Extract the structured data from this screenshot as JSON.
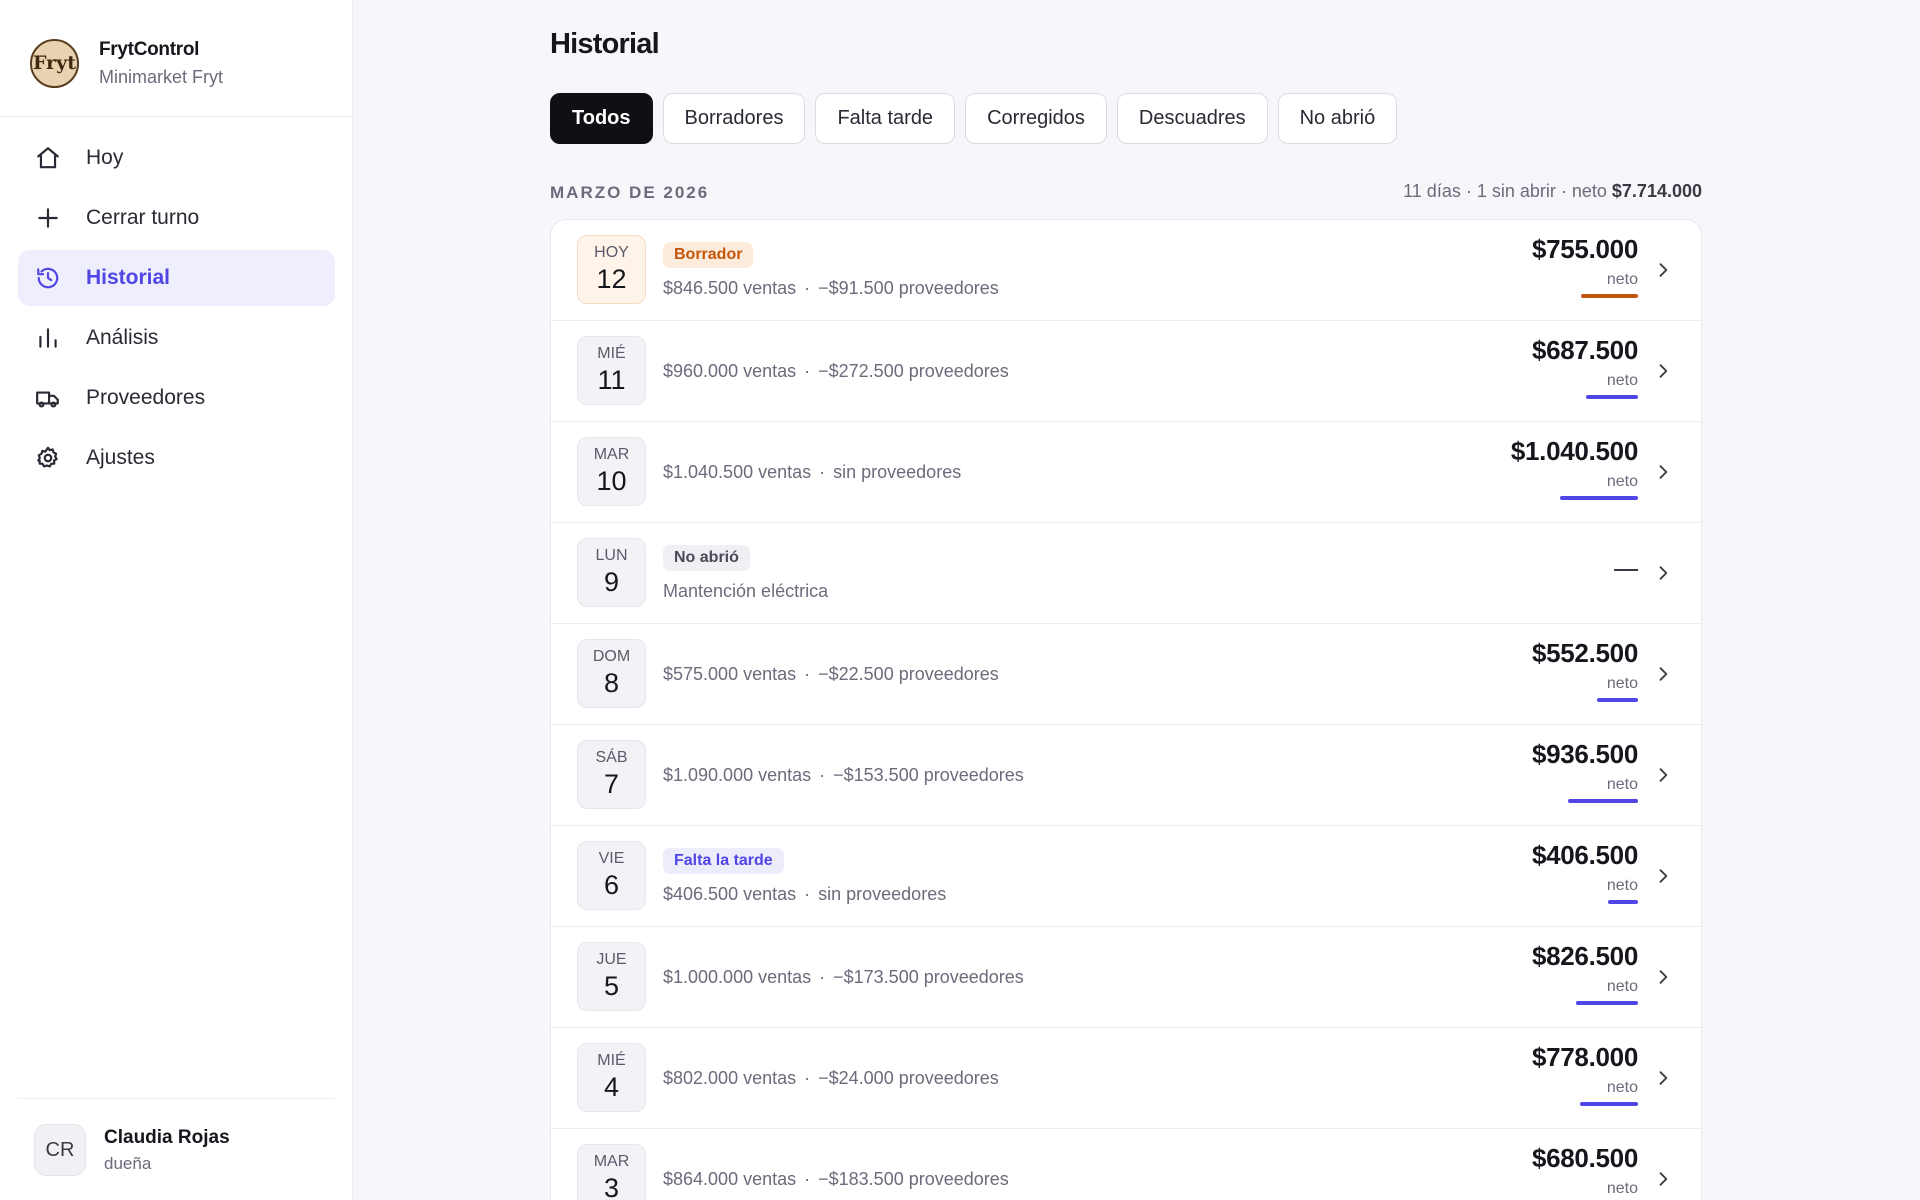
{
  "brand": {
    "name": "FrytControl",
    "subtitle": "Minimarket Fryt",
    "logo_text": "Fryt"
  },
  "nav": [
    {
      "label": "Hoy",
      "icon": "home-icon",
      "active": false
    },
    {
      "label": "Cerrar turno",
      "icon": "plus-icon",
      "active": false
    },
    {
      "label": "Historial",
      "icon": "history-icon",
      "active": true
    },
    {
      "label": "Análisis",
      "icon": "bar-chart-icon",
      "active": false
    },
    {
      "label": "Proveedores",
      "icon": "truck-icon",
      "active": false
    },
    {
      "label": "Ajustes",
      "icon": "gear-icon",
      "active": false
    }
  ],
  "user": {
    "initials": "CR",
    "name": "Claudia Rojas",
    "role": "dueña"
  },
  "page": {
    "title": "Historial"
  },
  "filters": [
    {
      "label": "Todos",
      "active": true
    },
    {
      "label": "Borradores",
      "active": false
    },
    {
      "label": "Falta tarde",
      "active": false
    },
    {
      "label": "Corregidos",
      "active": false
    },
    {
      "label": "Descuadres",
      "active": false
    },
    {
      "label": "No abrió",
      "active": false
    }
  ],
  "month": {
    "label": "MARZO DE 2026",
    "summary_prefix": "11 días · 1 sin abrir · neto ",
    "summary_total": "$7.714.000"
  },
  "colors": {
    "accent": "#4f46e5",
    "draft": "#c2570c"
  },
  "days": [
    {
      "dow": "HOY",
      "day": "12",
      "today": true,
      "badge": "Borrador",
      "badge_type": "draft",
      "sales": "$846.500 ventas",
      "suppliers": "−$91.500 proveedores",
      "net": "$755.000",
      "net_label": "neto",
      "net_value": 755000,
      "bar_color": "#c2570c"
    },
    {
      "dow": "MIÉ",
      "day": "11",
      "badge": "",
      "sales": "$960.000 ventas",
      "suppliers": "−$272.500 proveedores",
      "net": "$687.500",
      "net_label": "neto",
      "net_value": 687500,
      "bar_color": "#4f46e5"
    },
    {
      "dow": "MAR",
      "day": "10",
      "badge": "",
      "sales": "$1.040.500 ventas",
      "suppliers": "sin proveedores",
      "net": "$1.040.500",
      "net_label": "neto",
      "net_value": 1040500,
      "bar_color": "#4f46e5"
    },
    {
      "dow": "LUN",
      "day": "9",
      "badge": "No abrió",
      "badge_type": "closed",
      "note": "Mantención eléctrica",
      "net": "",
      "net_value": 0
    },
    {
      "dow": "DOM",
      "day": "8",
      "badge": "",
      "sales": "$575.000 ventas",
      "suppliers": "−$22.500 proveedores",
      "net": "$552.500",
      "net_label": "neto",
      "net_value": 552500,
      "bar_color": "#4f46e5"
    },
    {
      "dow": "SÁB",
      "day": "7",
      "badge": "",
      "sales": "$1.090.000 ventas",
      "suppliers": "−$153.500 proveedores",
      "net": "$936.500",
      "net_label": "neto",
      "net_value": 936500,
      "bar_color": "#4f46e5"
    },
    {
      "dow": "VIE",
      "day": "6",
      "badge": "Falta la tarde",
      "badge_type": "late",
      "sales": "$406.500 ventas",
      "suppliers": "sin proveedores",
      "net": "$406.500",
      "net_label": "neto",
      "net_value": 406500,
      "bar_color": "#4f46e5"
    },
    {
      "dow": "JUE",
      "day": "5",
      "badge": "",
      "sales": "$1.000.000 ventas",
      "suppliers": "−$173.500 proveedores",
      "net": "$826.500",
      "net_label": "neto",
      "net_value": 826500,
      "bar_color": "#4f46e5"
    },
    {
      "dow": "MIÉ",
      "day": "4",
      "badge": "",
      "sales": "$802.000 ventas",
      "suppliers": "−$24.000 proveedores",
      "net": "$778.000",
      "net_label": "neto",
      "net_value": 778000,
      "bar_color": "#4f46e5"
    },
    {
      "dow": "MAR",
      "day": "3",
      "badge": "",
      "sales": "$864.000 ventas",
      "suppliers": "−$183.500 proveedores",
      "net": "$680.500",
      "net_label": "neto",
      "net_value": 680500,
      "bar_color": "#4f46e5"
    }
  ]
}
